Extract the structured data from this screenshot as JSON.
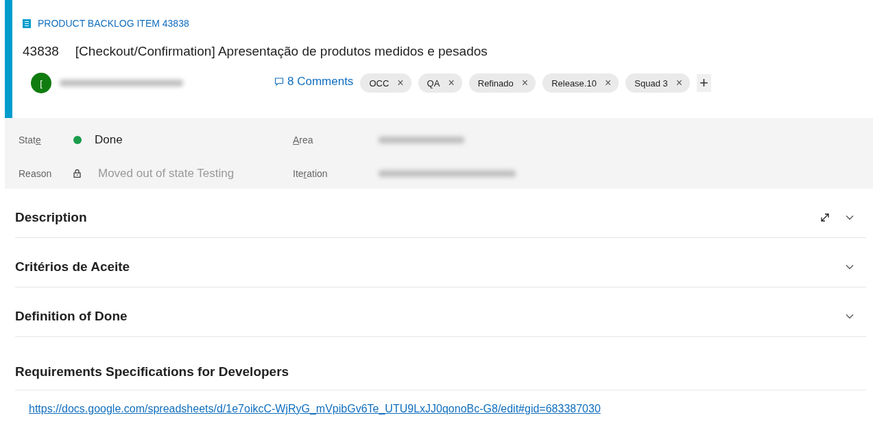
{
  "work_item": {
    "type": "PRODUCT BACKLOG ITEM 43838",
    "id": "43838",
    "title": "[Checkout/Confirmation] Apresentação de produtos medidos e pesados"
  },
  "assignee": {
    "initial": "[",
    "name_redacted": true
  },
  "comments": {
    "label": "8 Comments"
  },
  "tags": [
    {
      "label": "OCC",
      "remove": "×"
    },
    {
      "label": "QA",
      "remove": "×"
    },
    {
      "label": "Refinado",
      "remove": "×"
    },
    {
      "label": "Release.10",
      "remove": "×"
    },
    {
      "label": "Squad 3",
      "remove": "×"
    }
  ],
  "add_tag": "+",
  "fields": [
    {
      "kind": "state",
      "label": {
        "pre": "Stat",
        "key": "e"
      },
      "value": "Done",
      "color": "#1a9c4b"
    },
    {
      "kind": "redacted",
      "label": {
        "key": "A",
        "post": "rea"
      }
    },
    {
      "kind": "locked",
      "label": {
        "pre": "Reason"
      },
      "value": "Moved out of state Testing"
    },
    {
      "kind": "redacted",
      "label": {
        "pre": "Ite",
        "key": "r",
        "post": "ation"
      }
    }
  ],
  "sections": [
    {
      "title": "Description",
      "expand_button": true,
      "collapsible": true
    },
    {
      "title": "Critérios de Aceite",
      "expand_button": false,
      "collapsible": true
    },
    {
      "title": "Definition of Done",
      "expand_button": false,
      "collapsible": true
    },
    {
      "title": "Requirements Specifications for Developers",
      "expand_button": false,
      "collapsible": false,
      "link": "https://docs.google.com/spreadsheets/d/1e7oikcC-WjRyG_mVpibGv6Te_UTU9LxJJ0qonoBc-G8/edit#gid=683387030"
    }
  ]
}
